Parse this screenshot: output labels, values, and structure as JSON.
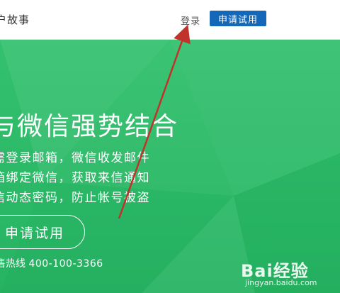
{
  "nav": {
    "customer_story": "户故事",
    "login": "登录",
    "trial_button": "申请试用"
  },
  "hero": {
    "headline": "与微信强势结合",
    "features": [
      "需登录邮箱，微信收发邮件",
      "箱绑定微信，获取来信通知",
      "信动态密码，防止帐号被盗"
    ],
    "trial_button": "申请试用",
    "hotline_label": "售热线",
    "hotline_number": "400-100-3366"
  },
  "watermark": {
    "logo_text": "Bai经验",
    "url": "jingyan.baidu.com"
  },
  "colors": {
    "primary_blue": "#1568b8",
    "hero_green": "#2bb967",
    "annotation_red": "#c0322b"
  },
  "icons": [
    "baidu-paw-icon"
  ]
}
